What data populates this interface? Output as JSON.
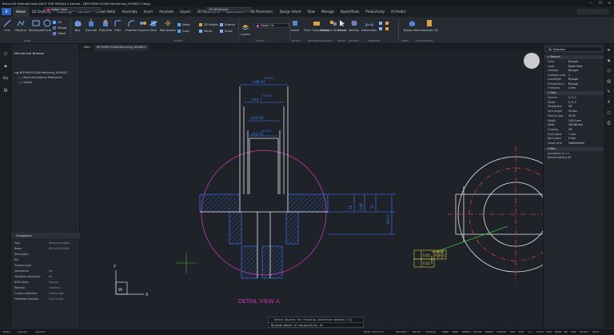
{
  "window": {
    "title": "BricsCAD Ultimate beta (NOT FOR RESALE License) - [BFY-9909-91008 Machining_ACM0017.dwg]",
    "controls": [
      "—",
      "❐",
      "✕"
    ]
  },
  "menu": {
    "logo": "B",
    "tabs": [
      "Home",
      "2D Drafting",
      "Modeling",
      "Surface",
      "Sheet Metal",
      "Assembly",
      "Insert",
      "Annotate",
      "Export",
      "2D Parametric",
      "Operations",
      "3D Parametric",
      "Design Intent",
      "View",
      "Manage",
      "BasketTools",
      "Productivity",
      "AI Predict"
    ],
    "active": "Home",
    "workspace": "Detail View",
    "layout": "2D Wireframe"
  },
  "ribbon": {
    "draw": [
      "Line",
      "Polyline",
      "Rectangle",
      "Circle"
    ],
    "draw_small": [
      "Fill",
      "Ellipse",
      "Hatch"
    ],
    "edit": [
      "Box",
      "Extrude",
      "Push/Pull",
      "Fillet",
      "Chamfer",
      "Connect",
      "Slice",
      "Manipulate"
    ],
    "modify_small": [
      "Move",
      "Copy",
      "3D Rotate",
      "Mirror",
      "Stretch",
      "Scale"
    ],
    "layers_label": "Layers",
    "layer_current": "Detail Vie",
    "insert": [
      "Insert",
      "Form Component",
      "Editable Structure",
      "Select",
      "Section",
      "Dimension"
    ],
    "view": [
      "Boxes View",
      "Absolute 2D"
    ],
    "groups": [
      "DRAW",
      "MODIFY",
      "LAYERS",
      "BLOCKS",
      "MECHANICAL BLOCKS",
      "SELECT",
      "SECTION",
      "ANNOTATE",
      "VIEWS",
      "CALCULATIONS"
    ]
  },
  "left_panel": {
    "title": "Mechanical Browser",
    "tree": [
      "BFY-9909-91008 Machining_ACM0017",
      "Block and External References",
      "Scripts"
    ],
    "component_header": "Component",
    "props": [
      {
        "k": "Type",
        "v": "Mechanical Block"
      },
      {
        "k": "Name",
        "v": "BFY-9909-91008"
      },
      {
        "k": "Description",
        "v": ""
      },
      {
        "k": "File",
        "v": ""
      },
      {
        "k": "Instance type",
        "v": ""
      },
      {
        "k": "Geometries",
        "v": "Yes"
      },
      {
        "k": "Standard component",
        "v": "No"
      },
      {
        "k": "BOM status",
        "v": "Regular"
      },
      {
        "k": "Material",
        "v": "<inherit>"
      },
      {
        "k": "Custom properties",
        "v": "Click to edit"
      },
      {
        "k": "Preferable direction",
        "v": "Click to edit"
      }
    ]
  },
  "doc_tabs": [
    "Start",
    "BFY-9909-91008 Machining_ACM0017"
  ],
  "drawing": {
    "dims_h": [
      "⌀38.01",
      "+0.014",
      "⌀34.7",
      "+0.016",
      "⌀32.01",
      "+0.013",
      "⌀31.01"
    ],
    "dims_v": [
      "38",
      "3.88",
      "13",
      "40.01"
    ],
    "gdt": [
      "0.05",
      "A",
      "B",
      "C",
      "0.01"
    ],
    "label": "DETAIL VIEW A",
    "ucs_x": "X",
    "ucs_y": "Y",
    "ucs_w": "W"
  },
  "command": {
    "line1": ": Select objects for resizing [selection options (?)]:",
    "line2": "Minimum amount of manipulation: 0>"
  },
  "right_panel": {
    "selection": "No Selection",
    "general_title": "General",
    "general": [
      {
        "k": "Color",
        "v": "ByLayer"
      },
      {
        "k": "Layer",
        "v": "Detail View"
      },
      {
        "k": "Linetype",
        "v": "ByLayer"
      },
      {
        "k": "Linetype scale",
        "v": "1"
      },
      {
        "k": "Lineweight",
        "v": "ByLayer"
      },
      {
        "k": "Transparency",
        "v": "ByLayer"
      },
      {
        "k": "Thickness",
        "v": "0 mm"
      }
    ],
    "view_title": "View",
    "view": [
      {
        "k": "Camera",
        "v": "0, 0, 1"
      },
      {
        "k": "Target",
        "v": "0, 0, 0"
      },
      {
        "k": "Perspective",
        "v": "Off"
      },
      {
        "k": "Lens length",
        "v": "50 mm"
      },
      {
        "k": "Field of view",
        "v": "39.59"
      },
      {
        "k": "Height",
        "v": "143.4 mm"
      },
      {
        "k": "Width",
        "v": "262.68 mm"
      },
      {
        "k": "Clipping",
        "v": "Off"
      },
      {
        "k": "Front plane",
        "v": "1 mm"
      },
      {
        "k": "Back plane",
        "v": "0 mm"
      },
      {
        "k": "Visual style",
        "v": "2dWireframe"
      }
    ],
    "misc_title": "Misc",
    "misc": [
      "Annotation sc 1:1",
      "Default lighting Off"
    ]
  },
  "status": {
    "left": [
      "Model",
      "Layout1",
      "Layout2"
    ],
    "right": [
      "58.51, 344.73, 0",
      "Standard",
      "ISO-25",
      "Drafting",
      "SNAP",
      "GRID",
      "ORTHO",
      "POLAR",
      "ESNAP",
      "STRACK",
      "LWT",
      "TILE",
      "1:1",
      "DUCS",
      "DYN",
      "QUAD",
      "RT",
      "HKA",
      "LOCKUI",
      "None"
    ]
  },
  "colors": {
    "magenta": "#c637b7",
    "blue": "#3b7dff",
    "yellow": "#d8c64a",
    "white": "#e6e6e6",
    "green": "#2fbf40",
    "red": "#d8403a"
  }
}
